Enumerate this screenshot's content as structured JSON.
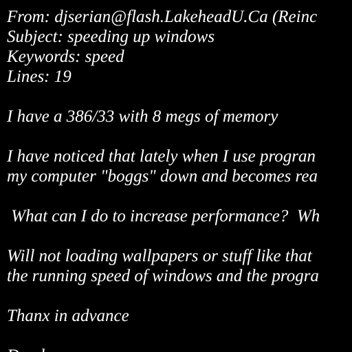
{
  "colors": {
    "background": "#000000",
    "text": "#ffffff"
  },
  "message": {
    "lines": [
      "From: djserian@flash.LakeheadU.Ca (Reinc",
      "Subject: speeding up windows",
      "Keywords: speed",
      "Lines: 19",
      "",
      "I have a 386/33 with 8 megs of memory",
      "",
      "I have noticed that lately when I use progran",
      "my computer \"boggs\" down and becomes rea",
      "",
      " What can I do to increase performance?  Wh",
      "",
      "Will not loading wallpapers or stuff like that",
      "the running speed of windows and the progra",
      "",
      "Thanx in advance",
      "",
      "Derek"
    ]
  }
}
